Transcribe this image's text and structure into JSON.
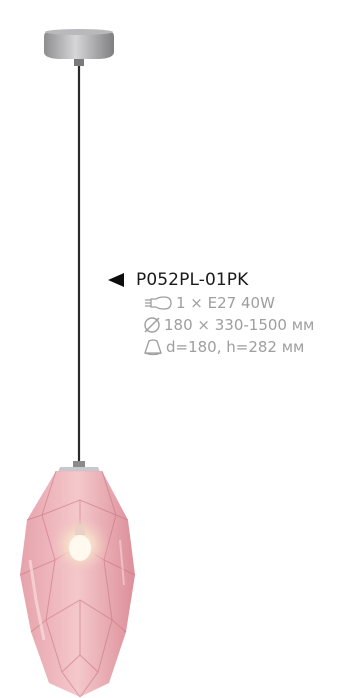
{
  "product": {
    "model": "P052PL-01PK",
    "specs": {
      "bulb": "1 × E27 40W",
      "dimensions": "180 × 330-1500 мм",
      "shade": "d=180, h=282 мм"
    }
  },
  "icons": {
    "pointer": "left-triangle-pointer-icon",
    "bulb": "bulb-icon",
    "diameter": "diameter-icon",
    "shade": "lampshade-icon"
  },
  "colors": {
    "shade_pink": "#e8a0a8",
    "canopy_gray": "#a9a9ab",
    "cord": "#2a2a2a",
    "spec_text": "#9e9e9e",
    "model_text": "#1a1a1a"
  }
}
